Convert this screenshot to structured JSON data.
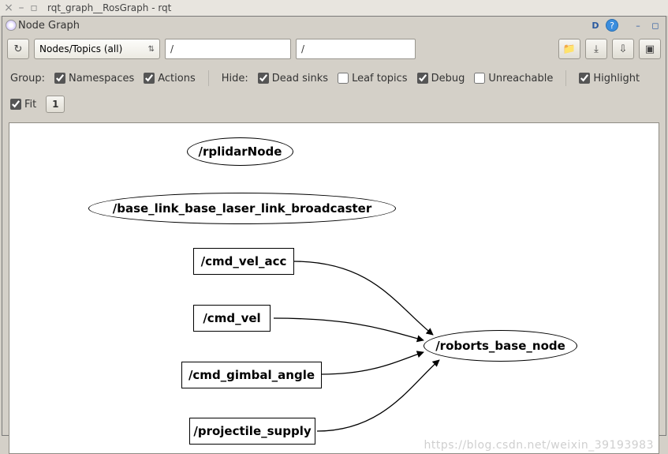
{
  "window": {
    "title": "rqt_graph__RosGraph - rqt"
  },
  "panel": {
    "title": "Node Graph"
  },
  "toolbar": {
    "reload_icon": "↻",
    "filter_select": "Nodes/Topics (all)",
    "ns_filter": "/",
    "topic_filter": "/",
    "open_icon": "📁",
    "save_icon": "⤓",
    "down_icon": "⇩",
    "image_icon": "▣"
  },
  "filters": {
    "group_label": "Group:",
    "namespaces_label": "Namespaces",
    "namespaces_checked": true,
    "actions_label": "Actions",
    "actions_checked": true,
    "hide_label": "Hide:",
    "deadsinks_label": "Dead sinks",
    "deadsinks_checked": true,
    "leaftopics_label": "Leaf topics",
    "leaftopics_checked": false,
    "debug_label": "Debug",
    "debug_checked": true,
    "unreachable_label": "Unreachable",
    "unreachable_checked": false,
    "highlight_label": "Highlight",
    "highlight_checked": true,
    "fit_label": "Fit",
    "fit_checked": true,
    "depth_value": "1"
  },
  "graph": {
    "nodes": {
      "rplidar": "/rplidarNode",
      "broadcaster": "/base_link_base_laser_link_broadcaster",
      "cmd_vel_acc": "/cmd_vel_acc",
      "cmd_vel": "/cmd_vel",
      "cmd_gimbal_angle": "/cmd_gimbal_angle",
      "projectile_supply": "/projectile_supply",
      "roborts_base": "/roborts_base_node"
    }
  },
  "watermark": "https://blog.csdn.net/weixin_39193983"
}
